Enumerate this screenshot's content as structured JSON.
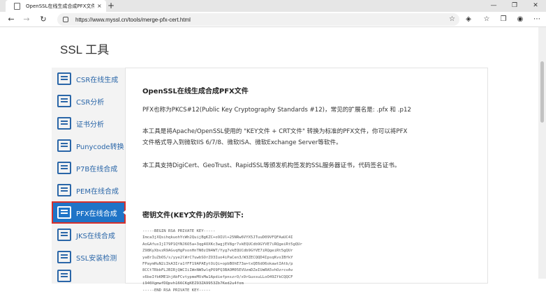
{
  "browser": {
    "tab_title": "OpenSSL在线生成合成PFX文件",
    "tab_close": "×",
    "new_tab": "+",
    "window_controls": [
      "—",
      "❐",
      "✕"
    ],
    "url": "https://www.myssl.cn/tools/merge-pfx-cert.html",
    "nav": {
      "back": "←",
      "forward": "→",
      "refresh": "↻"
    }
  },
  "site": {
    "title": "SSL 工具"
  },
  "sidebar": {
    "items": [
      {
        "label": "CSR在线生成",
        "icon": "check-window-icon",
        "active": false
      },
      {
        "label": "CSR分析",
        "icon": "document-icon",
        "active": false
      },
      {
        "label": "证书分析",
        "icon": "certificate-icon",
        "active": false
      },
      {
        "label": "Punycode转换",
        "icon": "convert-icon",
        "active": false
      },
      {
        "label": "P7B在线合成",
        "icon": "merge-icon",
        "active": false
      },
      {
        "label": "PEM在线合成",
        "icon": "merge-icon",
        "active": false
      },
      {
        "label": "PFX在线合成",
        "icon": "merge-icon",
        "active": true
      },
      {
        "label": "JKS在线合成",
        "icon": "merge-icon",
        "active": false
      },
      {
        "label": "SSL安装检测",
        "icon": "shield-icon",
        "active": false
      },
      {
        "label": "",
        "icon": "globe-icon",
        "active": false
      }
    ]
  },
  "content": {
    "heading": "OpenSSL在线生成合成PFX文件",
    "para1": "PFX也称为PKCS#12(Public Key Cryptography Standards #12)，常见的扩展名是: .pfx 和 .p12",
    "para2_line1": "本工具是将Apache/OpenSSL使用的 \"KEY文件 + CRT文件\" 转换为标准的PFX文件，你可以将PFX",
    "para2_line2": "文件格式导入到微软IIS 6/7/8、微软ISA、微软Exchange Server等软件。",
    "para3": "本工具支持DigiCert、GeoTrust、RapidSSL等颁发机构签发的SSL服务器证书，代码签名证书。",
    "key_heading": "密钥文件(KEY文件)的示例如下:",
    "key_sample": [
      "-----BEGIN RSA PRIVATE KEY-----",
      "Imca3jXQsihqkuohYcWh2QuijBgKZC+o9IUl+25NRw6VYX5JTuuD09VFQFAaUC4I",
      "AoGAfusIjI79P1QYNJ6O5a+3qg4OXKc3wgjEV8gr7vkEQUCdb9GYVE7iRQgeiRt5gQUr",
      "Z98KyXbvzR9AGvqHgPxonHnTN0zIN4WT/Yyg7vkEQUCdb9GYVE7iRQgeiRt5gQUr",
      "ya8rIuZbOS/s/yye2lWrC7uwbSOrZO3Iuo4iPaCen3/W3ZECQQD4IpsqKvsIBfkY",
      "FPaymHuN2iIkA3Ira1fFF19APAEytOiQi+opbBOhE73a+txQE6dO6okawtIAtb/p",
      "8CCtTRbbFLJBIRjQWCIiIWnNW5wlqPO9FQ3BAOM05EVUzmDZeIUmRA5vhOzrcvAv",
      "s6beIfbKME1hjAbFCvtypmeMVsMw1ApdiefpnszrO/x9rGuxsuLLoO49ZfkCQQCF",
      "i940XgmwfDQpvh166CKgKEZ93ZA9953Zb7Ked2u4fom",
      "-----END RSA PRIVATE KEY-----"
    ]
  }
}
